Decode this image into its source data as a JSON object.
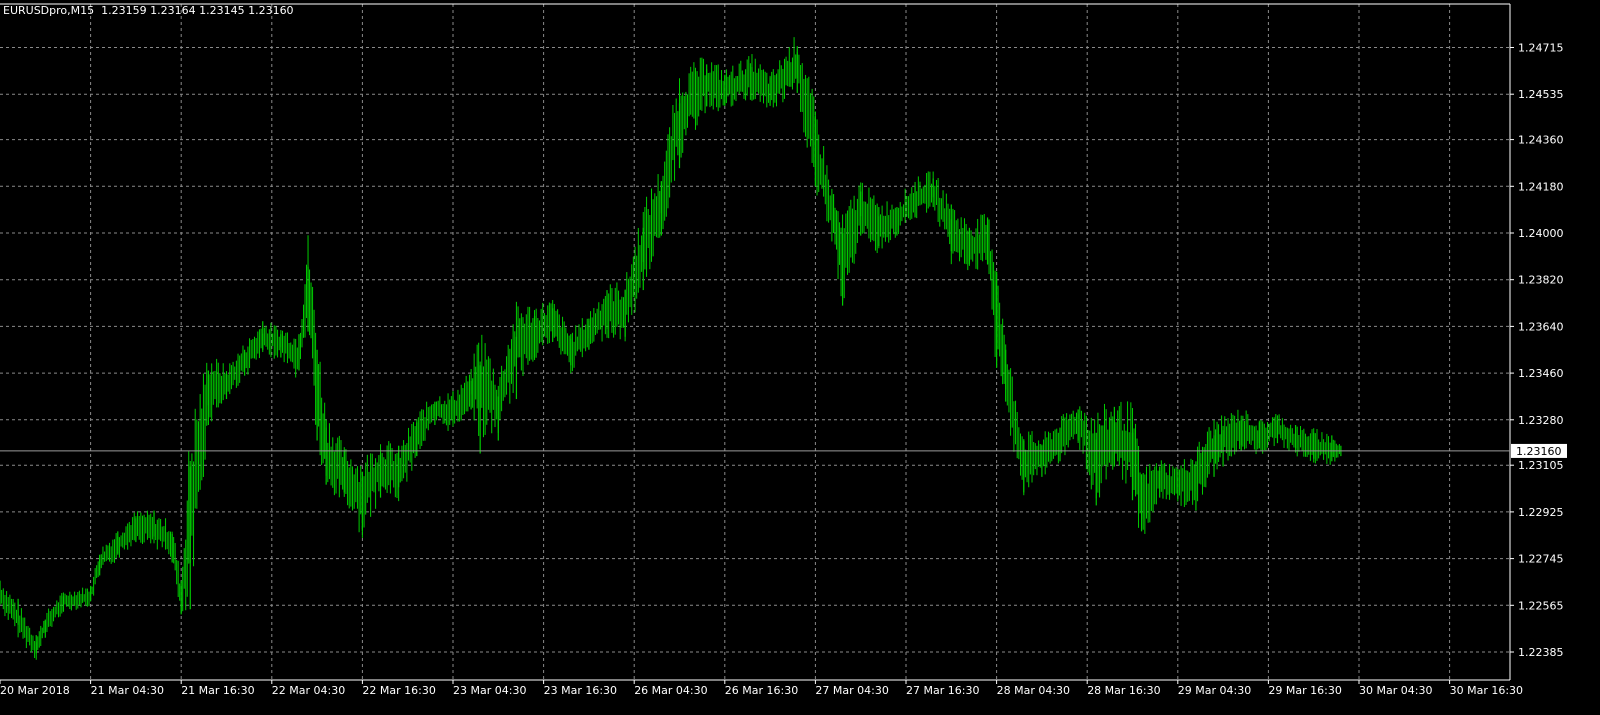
{
  "window": {
    "symbol_info": "EURUSDpro,M15  1.23159 1.23164 1.23145 1.23160"
  },
  "colors": {
    "background": "#000000",
    "grid": "#8a8a8a",
    "axis": "#ffffff",
    "bars": "#00cc00",
    "current_price_line": "#9a9a9a"
  },
  "chart_data": {
    "type": "line",
    "symbol": "EURUSDpro",
    "timeframe": "M15",
    "ohlc": {
      "open": 1.23159,
      "high": 1.23164,
      "low": 1.23145,
      "close": 1.2316
    },
    "current_price_label": "1.23160",
    "current_price": 1.2316,
    "y_ticks": [
      "1.24715",
      "1.24535",
      "1.24360",
      "1.24180",
      "1.24000",
      "1.23820",
      "1.23640",
      "1.23460",
      "1.23280",
      "1.23105",
      "1.22925",
      "1.22745",
      "1.22565",
      "1.22385"
    ],
    "y_tick_values": [
      1.24715,
      1.24535,
      1.2436,
      1.2418,
      1.24,
      1.2382,
      1.2364,
      1.2346,
      1.2328,
      1.23105,
      1.22925,
      1.22745,
      1.22565,
      1.22385
    ],
    "x_ticks": [
      "20 Mar 2018",
      "21 Mar 04:30",
      "21 Mar 16:30",
      "22 Mar 04:30",
      "22 Mar 16:30",
      "23 Mar 04:30",
      "23 Mar 16:30",
      "26 Mar 04:30",
      "26 Mar 16:30",
      "27 Mar 04:30",
      "27 Mar 16:30",
      "28 Mar 04:30",
      "28 Mar 16:30",
      "29 Mar 04:30",
      "29 Mar 16:30",
      "30 Mar 04:30",
      "30 Mar 16:30"
    ],
    "ylim": [
      1.2234,
      1.2477
    ],
    "grid": true,
    "series": [
      {
        "values": [
          [
            0,
            1.2263,
            1.2261,
            1.2266,
            1.2257
          ],
          [
            0.2,
            1.2257,
            1.2251,
            1.2259,
            1.2249
          ],
          [
            0.4,
            1.2243,
            1.224,
            1.2245,
            1.2238
          ],
          [
            0.5,
            1.2247,
            1.2249,
            1.2251,
            1.2244
          ],
          [
            0.7,
            1.2256,
            1.2258,
            1.226,
            1.2254
          ],
          [
            1.0,
            1.2262,
            1.226,
            1.2264,
            1.2258
          ],
          [
            1.1,
            1.2271,
            1.2273,
            1.2276,
            1.2268
          ],
          [
            1.3,
            1.2281,
            1.228,
            1.2285,
            1.2276
          ],
          [
            1.5,
            1.2286,
            1.2287,
            1.229,
            1.2281
          ],
          [
            1.7,
            1.229,
            1.2286,
            1.2293,
            1.2283
          ],
          [
            1.9,
            1.2279,
            1.2281,
            1.2284,
            1.2273
          ],
          [
            2.0,
            1.226,
            1.2258,
            1.2266,
            1.2253
          ],
          [
            2.1,
            1.2265,
            1.229,
            1.231,
            1.2255
          ],
          [
            2.3,
            1.233,
            1.234,
            1.2347,
            1.2326
          ],
          [
            2.5,
            1.234,
            1.2342,
            1.2346,
            1.2336
          ],
          [
            2.7,
            1.2348,
            1.2351,
            1.2355,
            1.2345
          ],
          [
            2.9,
            1.2362,
            1.2359,
            1.2366,
            1.2355
          ],
          [
            3.1,
            1.2356,
            1.2358,
            1.2361,
            1.2352
          ],
          [
            3.3,
            1.2358,
            1.2352,
            1.2361,
            1.2347
          ],
          [
            3.4,
            1.2375,
            1.2383,
            1.2387,
            1.2362
          ],
          [
            3.5,
            1.235,
            1.234,
            1.2355,
            1.232
          ],
          [
            3.6,
            1.232,
            1.2315,
            1.2328,
            1.2303
          ],
          [
            3.8,
            1.231,
            1.2307,
            1.2316,
            1.23
          ],
          [
            4.0,
            1.2302,
            1.2298,
            1.2308,
            1.2285
          ],
          [
            4.2,
            1.2305,
            1.231,
            1.2315,
            1.2298
          ],
          [
            4.4,
            1.2312,
            1.2307,
            1.2318,
            1.2302
          ],
          [
            4.6,
            1.232,
            1.2322,
            1.2327,
            1.2314
          ],
          [
            4.8,
            1.233,
            1.2332,
            1.2335,
            1.2326
          ],
          [
            5.0,
            1.2334,
            1.2331,
            1.2339,
            1.2327
          ],
          [
            5.2,
            1.2337,
            1.234,
            1.2343,
            1.2332
          ],
          [
            5.3,
            1.2345,
            1.2342,
            1.2349,
            1.2315
          ],
          [
            5.5,
            1.233,
            1.2334,
            1.2337,
            1.232
          ],
          [
            5.7,
            1.235,
            1.2357,
            1.236,
            1.2336
          ],
          [
            5.9,
            1.2358,
            1.2362,
            1.2368,
            1.2352
          ],
          [
            6.1,
            1.2364,
            1.2366,
            1.2371,
            1.2358
          ],
          [
            6.3,
            1.2356,
            1.2354,
            1.2361,
            1.2349
          ],
          [
            6.5,
            1.236,
            1.2362,
            1.2367,
            1.2355
          ],
          [
            6.7,
            1.2368,
            1.237,
            1.2378,
            1.2363
          ],
          [
            6.9,
            1.2372,
            1.237,
            1.2378,
            1.236
          ],
          [
            7.1,
            1.2385,
            1.2395,
            1.2402,
            1.2378
          ],
          [
            7.3,
            1.241,
            1.2412,
            1.242,
            1.2399
          ],
          [
            7.5,
            1.2437,
            1.2445,
            1.245,
            1.2425
          ],
          [
            7.8,
            1.2455,
            1.2458,
            1.2465,
            1.2449
          ],
          [
            8.0,
            1.2458,
            1.2455,
            1.2461,
            1.2449
          ],
          [
            8.3,
            1.2458,
            1.246,
            1.2464,
            1.2451
          ],
          [
            8.5,
            1.2456,
            1.2454,
            1.246,
            1.2449
          ],
          [
            8.8,
            1.2461,
            1.2465,
            1.2472,
            1.2454
          ],
          [
            9.0,
            1.244,
            1.2432,
            1.2445,
            1.2418
          ],
          [
            9.2,
            1.241,
            1.2405,
            1.2415,
            1.24
          ],
          [
            9.3,
            1.2395,
            1.2388,
            1.24,
            1.2372
          ],
          [
            9.5,
            1.2405,
            1.241,
            1.2416,
            1.2399
          ],
          [
            9.7,
            1.2406,
            1.2402,
            1.241,
            1.2395
          ],
          [
            9.9,
            1.2403,
            1.2406,
            1.241,
            1.2399
          ],
          [
            10.1,
            1.2411,
            1.2413,
            1.2418,
            1.2406
          ],
          [
            10.3,
            1.2415,
            1.2417,
            1.2421,
            1.241
          ],
          [
            10.5,
            1.2405,
            1.24,
            1.2411,
            1.2393
          ],
          [
            10.7,
            1.2396,
            1.2395,
            1.2402,
            1.2388
          ],
          [
            10.9,
            1.2402,
            1.2396,
            1.2406,
            1.2388
          ],
          [
            11.0,
            1.238,
            1.237,
            1.2385,
            1.2348
          ],
          [
            11.1,
            1.235,
            1.2345,
            1.2355,
            1.2335
          ],
          [
            11.3,
            1.2315,
            1.2311,
            1.232,
            1.23
          ],
          [
            11.5,
            1.2312,
            1.2314,
            1.2318,
            1.2306
          ],
          [
            11.7,
            1.2318,
            1.232,
            1.2325,
            1.2312
          ],
          [
            11.9,
            1.2325,
            1.2327,
            1.2332,
            1.232
          ],
          [
            12.1,
            1.2318,
            1.2313,
            1.2323,
            1.2295
          ],
          [
            12.3,
            1.2325,
            1.232,
            1.2333,
            1.231
          ],
          [
            12.5,
            1.2315,
            1.2317,
            1.2323,
            1.2297
          ],
          [
            12.6,
            1.23,
            1.2295,
            1.2307,
            1.2285
          ],
          [
            12.8,
            1.2303,
            1.2305,
            1.231,
            1.2298
          ],
          [
            13.0,
            1.2305,
            1.2303,
            1.2309,
            1.2298
          ],
          [
            13.2,
            1.2307,
            1.2305,
            1.2312,
            1.2293
          ],
          [
            13.4,
            1.2314,
            1.2318,
            1.2322,
            1.2306
          ],
          [
            13.5,
            1.2313,
            1.232,
            1.2324,
            1.231
          ],
          [
            13.7,
            1.2322,
            1.2325,
            1.2328,
            1.2316
          ],
          [
            13.9,
            1.2324,
            1.2321,
            1.2327,
            1.2317
          ],
          [
            14.1,
            1.2323,
            1.2325,
            1.2328,
            1.2319
          ],
          [
            14.3,
            1.2322,
            1.232,
            1.2326,
            1.2317
          ],
          [
            14.5,
            1.232,
            1.2318,
            1.2323,
            1.2313
          ],
          [
            14.7,
            1.2318,
            1.2316,
            1.2322,
            1.2312
          ],
          [
            14.8,
            1.2316,
            1.2316,
            1.2318,
            1.2314
          ]
        ]
      }
    ]
  }
}
